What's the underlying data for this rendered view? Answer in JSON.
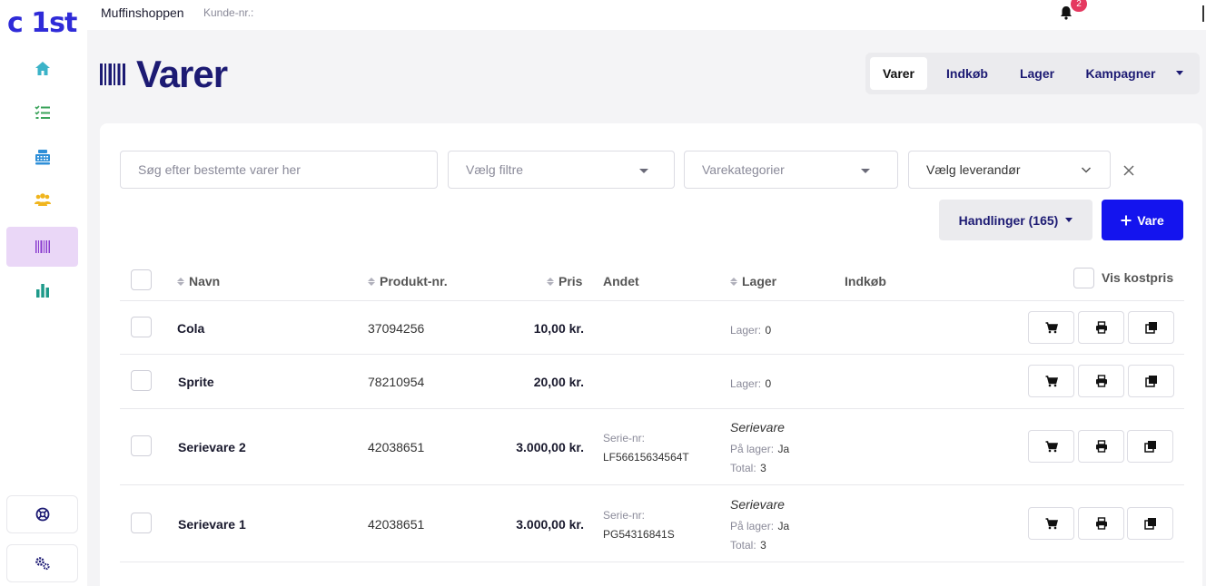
{
  "brand": {
    "logo": "c 1st"
  },
  "topbar": {
    "shop_name": "Muffinshoppen",
    "customer_label": "Kunde-nr.:",
    "notification_count": "2"
  },
  "page": {
    "title": "Varer"
  },
  "tabs": [
    {
      "label": "Varer",
      "active": true
    },
    {
      "label": "Indkøb",
      "active": false
    },
    {
      "label": "Lager",
      "active": false
    },
    {
      "label": "Kampagner",
      "active": false
    }
  ],
  "filters": {
    "search_placeholder": "Søg efter bestemte varer her",
    "filter_label": "Vælg filtre",
    "category_label": "Varekategorier",
    "supplier_label": "Vælg leverandør"
  },
  "actions": {
    "handlinger_label": "Handlinger (165)",
    "add_label": "Vare"
  },
  "table": {
    "headers": {
      "name": "Navn",
      "product_no": "Produkt-nr.",
      "price": "Pris",
      "other": "Andet",
      "stock": "Lager",
      "purchase": "Indkøb",
      "show_cost": "Vis kostpris"
    },
    "rows": [
      {
        "name": "Cola",
        "product_no": "37094256",
        "price": "10,00 kr.",
        "stock_label": "Lager:",
        "stock_value": "0"
      },
      {
        "name": "Sprite",
        "product_no": "78210954",
        "price": "20,00 kr.",
        "stock_label": "Lager:",
        "stock_value": "0"
      },
      {
        "name": "Serievare 2",
        "product_no": "42038651",
        "price": "3.000,00 kr.",
        "serial_label": "Serie-nr:",
        "serial_value": "LF56615634564T",
        "type": "Serievare",
        "in_stock_label": "På lager:",
        "in_stock_value": "Ja",
        "total_label": "Total:",
        "total_value": "3"
      },
      {
        "name": "Serievare 1",
        "product_no": "42038651",
        "price": "3.000,00 kr.",
        "serial_label": "Serie-nr:",
        "serial_value": "PG54316841S",
        "type": "Serievare",
        "in_stock_label": "På lager:",
        "in_stock_value": "Ja",
        "total_label": "Total:",
        "total_value": "3"
      }
    ]
  },
  "colors": {
    "primary": "#1414ee",
    "brand": "#2f2bd8",
    "title": "#1c1a73",
    "active_nav": "#ead7f7",
    "badge": "#e53960"
  }
}
